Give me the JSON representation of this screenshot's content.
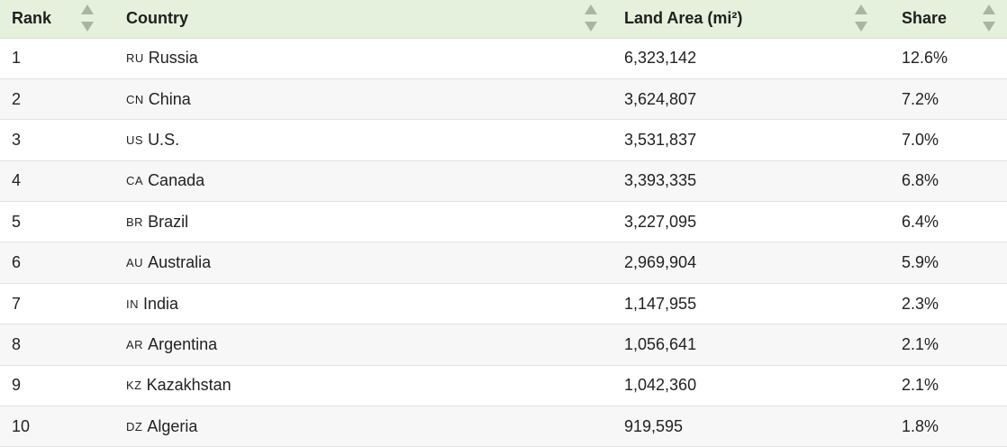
{
  "table": {
    "headers": [
      "Rank",
      "Country",
      "Land Area (mi²)",
      "Share"
    ],
    "rows": [
      {
        "rank": "1",
        "code": "RU",
        "country": "Russia",
        "area": "6,323,142",
        "share": "12.6%"
      },
      {
        "rank": "2",
        "code": "CN",
        "country": "China",
        "area": "3,624,807",
        "share": "7.2%"
      },
      {
        "rank": "3",
        "code": "US",
        "country": "U.S.",
        "area": "3,531,837",
        "share": "7.0%"
      },
      {
        "rank": "4",
        "code": "CA",
        "country": "Canada",
        "area": "3,393,335",
        "share": "6.8%"
      },
      {
        "rank": "5",
        "code": "BR",
        "country": "Brazil",
        "area": "3,227,095",
        "share": "6.4%"
      },
      {
        "rank": "6",
        "code": "AU",
        "country": "Australia",
        "area": "2,969,904",
        "share": "5.9%"
      },
      {
        "rank": "7",
        "code": "IN",
        "country": "India",
        "area": "1,147,955",
        "share": "2.3%"
      },
      {
        "rank": "8",
        "code": "AR",
        "country": "Argentina",
        "area": "1,056,641",
        "share": "2.1%"
      },
      {
        "rank": "9",
        "code": "KZ",
        "country": "Kazakhstan",
        "area": "1,042,360",
        "share": "2.1%"
      },
      {
        "rank": "10",
        "code": "DZ",
        "country": "Algeria",
        "area": "919,595",
        "share": "1.8%"
      }
    ]
  },
  "colors": {
    "header_bg": "#e5f0dd",
    "sort_icon": "#a9b4a3",
    "row_alt_bg": "#f7f7f7",
    "row_border": "#e2e2e2"
  }
}
